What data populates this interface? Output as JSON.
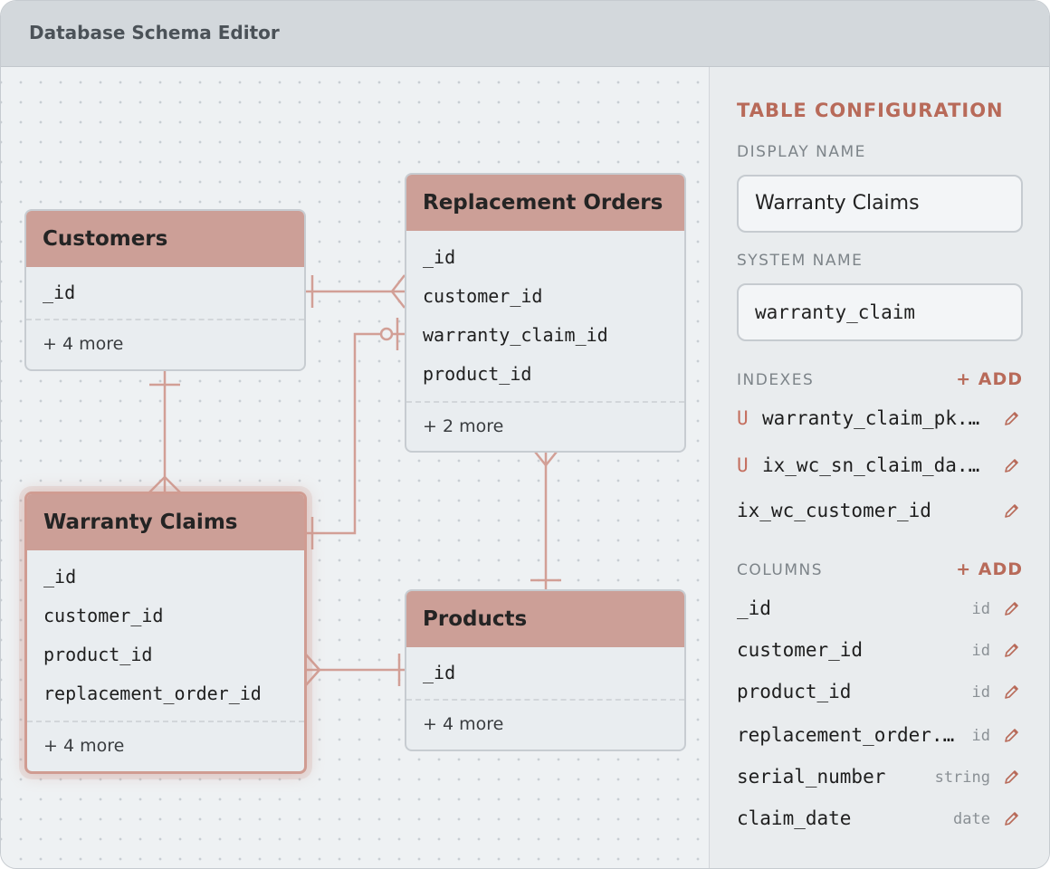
{
  "window": {
    "title": "Database Schema Editor"
  },
  "entities": {
    "customers": {
      "title": "Customers",
      "fields": [
        "_id"
      ],
      "more": "+ 4 more"
    },
    "replacement_orders": {
      "title": "Replacement Orders",
      "fields": [
        "_id",
        "customer_id",
        "warranty_claim_id",
        "product_id"
      ],
      "more": "+ 2 more"
    },
    "warranty_claims": {
      "title": "Warranty Claims",
      "fields": [
        "_id",
        "customer_id",
        "product_id",
        "replacement_order_id"
      ],
      "more": "+ 4 more"
    },
    "products": {
      "title": "Products",
      "fields": [
        "_id"
      ],
      "more": "+ 4 more"
    }
  },
  "panel": {
    "heading": "TABLE CONFIGURATION",
    "display_name_label": "DISPLAY NAME",
    "display_name_value": "Warranty Claims",
    "system_name_label": "SYSTEM NAME",
    "system_name_value": "warranty_claim",
    "indexes_label": "INDEXES",
    "indexes_add": "+ ADD",
    "indexes": [
      {
        "unique_mark": "U",
        "name": "warranty_claim_pk..."
      },
      {
        "unique_mark": "U",
        "name": "ix_wc_sn_claim_da..."
      },
      {
        "unique_mark": "",
        "name": "ix_wc_customer_id"
      }
    ],
    "columns_label": "COLUMNS",
    "columns_add": "+ ADD",
    "columns": [
      {
        "name": "_id",
        "type": "id"
      },
      {
        "name": "customer_id",
        "type": "id"
      },
      {
        "name": "product_id",
        "type": "id"
      },
      {
        "name": "replacement_order...",
        "type": "id"
      },
      {
        "name": "serial_number",
        "type": "string"
      },
      {
        "name": "claim_date",
        "type": "date"
      }
    ]
  },
  "colors": {
    "accent": "#b86a59",
    "entity_header": "#cc9f97",
    "link": "#d29f96"
  },
  "icons": {
    "edit": "pencil-icon"
  }
}
